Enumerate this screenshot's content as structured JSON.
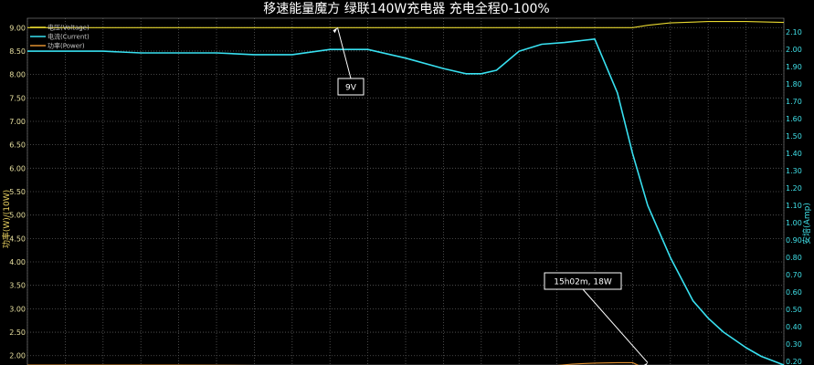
{
  "chart_data": {
    "type": "line",
    "title": "移速能量魔方  绿联140W充电器  充电全程0-100%",
    "ylabel_left": "功率(W)/(10W)",
    "ylabel_right": "安培(Amp)",
    "ylim_left": [
      1.8,
      9.2
    ],
    "ylim_right": [
      0.18,
      2.18
    ],
    "yticks_left": [
      "9.00",
      "8.50",
      "8.00",
      "7.50",
      "7.00",
      "6.50",
      "6.00",
      "5.50",
      "5.00",
      "4.50",
      "4.00",
      "3.50",
      "3.00",
      "2.50",
      "2.00"
    ],
    "yticks_right": [
      "2.10",
      "2.00",
      "1.90",
      "1.80",
      "1.70",
      "1.60",
      "1.50",
      "1.40",
      "1.30",
      "1.20",
      "1.10",
      "1.00",
      "0.90",
      "0.80",
      "0.70",
      "0.60",
      "0.50",
      "0.40",
      "0.30",
      "0.20"
    ],
    "xlim": [
      0,
      100
    ],
    "grid": true,
    "legend_position": "top-left",
    "series": [
      {
        "name": "电压(Voltage)",
        "axis": "left",
        "color": "#e8d830",
        "x": [
          0,
          10,
          20,
          30,
          40,
          50,
          60,
          70,
          75,
          80,
          82,
          85,
          90,
          95,
          100
        ],
        "y": [
          9.0,
          9.0,
          9.0,
          9.0,
          9.0,
          9.0,
          9.0,
          9.0,
          9.0,
          9.0,
          9.05,
          9.1,
          9.13,
          9.13,
          9.11
        ]
      },
      {
        "name": "电流(Current)",
        "axis": "right",
        "color": "#38e0f0",
        "x": [
          0,
          5,
          10,
          15,
          20,
          25,
          30,
          35,
          40,
          45,
          50,
          55,
          58,
          60,
          62,
          65,
          68,
          71,
          73,
          75,
          78,
          80,
          82,
          85,
          88,
          90,
          92,
          95,
          97,
          100
        ],
        "y": [
          1.99,
          1.99,
          1.99,
          1.98,
          1.98,
          1.98,
          1.97,
          1.97,
          2.0,
          2.0,
          1.95,
          1.89,
          1.86,
          1.86,
          1.88,
          1.99,
          2.03,
          2.04,
          2.05,
          2.06,
          1.75,
          1.4,
          1.1,
          0.8,
          0.55,
          0.45,
          0.37,
          0.28,
          0.23,
          0.18
        ]
      },
      {
        "name": "功率(Power)",
        "axis": "left",
        "color": "#e09030",
        "x": [
          0,
          10,
          20,
          30,
          40,
          50,
          60,
          65,
          70,
          72,
          75,
          78,
          80,
          82,
          84
        ],
        "y": [
          1.8,
          1.8,
          1.8,
          1.79,
          1.79,
          1.79,
          1.78,
          1.78,
          1.79,
          1.82,
          1.84,
          1.85,
          1.85,
          1.7,
          1.5
        ]
      }
    ],
    "annotations": [
      {
        "text": "9V",
        "target_x": 41,
        "target_y_left": 9.0
      },
      {
        "text": "15h02m, 18W",
        "target_x": 82,
        "target_y_left": 1.85
      }
    ]
  }
}
